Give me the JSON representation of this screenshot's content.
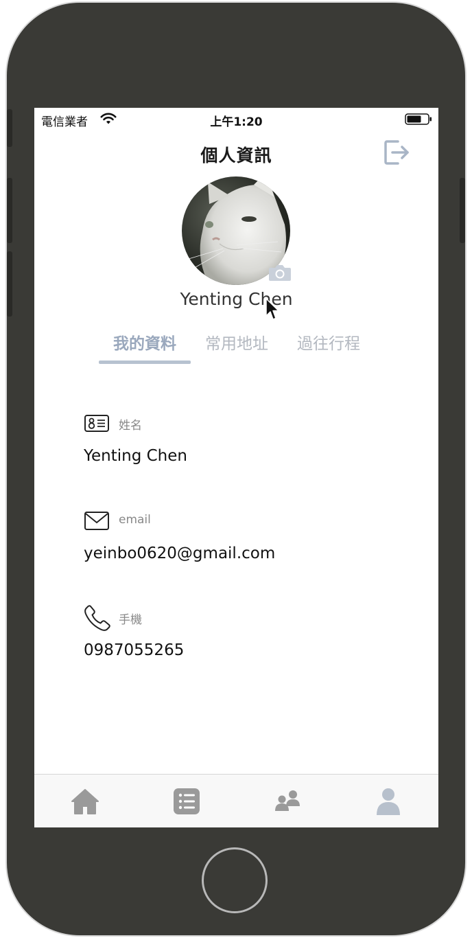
{
  "status_bar": {
    "carrier": "電信業者",
    "time": "上午1:20"
  },
  "header": {
    "title": "個人資訊",
    "logout_icon": "logout-icon"
  },
  "profile": {
    "avatar_icon": "cat-avatar",
    "camera_icon": "camera-icon",
    "name": "Yenting Chen"
  },
  "tabs": [
    {
      "label": "我的資料",
      "active": true
    },
    {
      "label": "常用地址",
      "active": false
    },
    {
      "label": "過往行程",
      "active": false
    }
  ],
  "fields": {
    "name": {
      "icon": "id-card-icon",
      "label": "姓名",
      "value": "Yenting Chen"
    },
    "email": {
      "icon": "envelope-icon",
      "label": "email",
      "value": "yeinbo0620@gmail.com"
    },
    "phone": {
      "icon": "phone-icon",
      "label": "手機",
      "value": "0987055265"
    }
  },
  "bottom_nav": [
    {
      "icon": "home-icon",
      "active": false
    },
    {
      "icon": "list-icon",
      "active": false
    },
    {
      "icon": "friends-icon",
      "active": false
    },
    {
      "icon": "profile-icon",
      "active": true
    }
  ],
  "colors": {
    "accent": "#9aa8bd",
    "tab_inactive": "#b3b8c0",
    "nav_inactive": "#9a9a9a",
    "nav_active": "#b7c0cc"
  }
}
